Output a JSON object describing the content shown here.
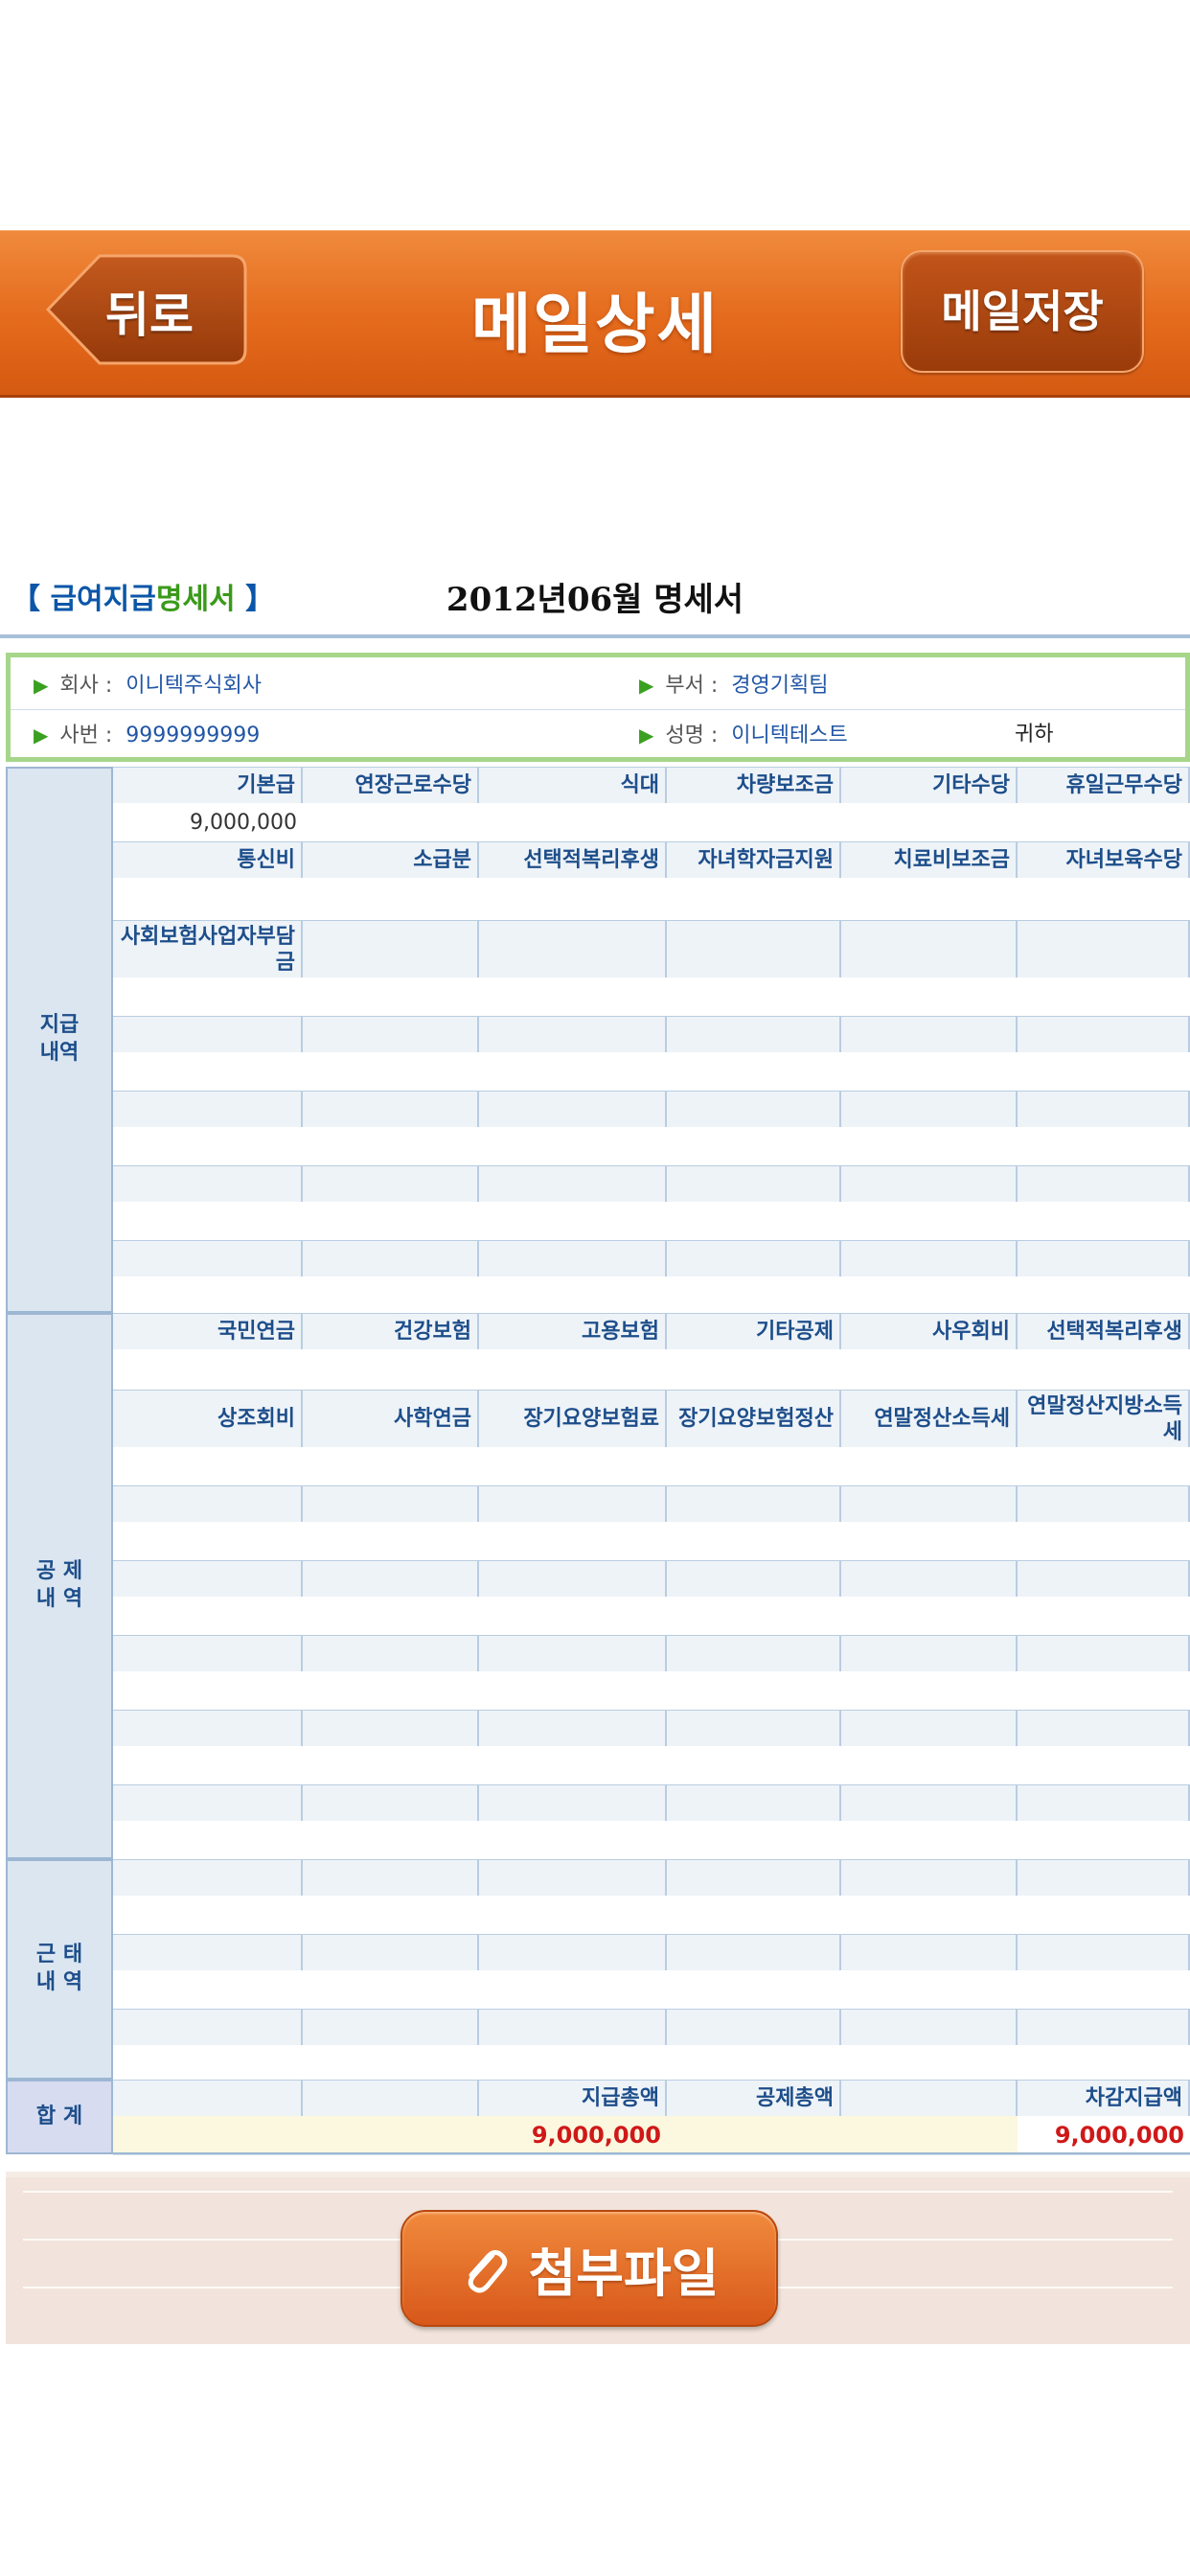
{
  "header": {
    "back_label": "뒤로",
    "title": "메일상세",
    "save_label": "메일저장"
  },
  "document": {
    "label_open": "【 급여지급",
    "label_hi": "명세서",
    "label_close": " 】",
    "title": "2012년06월 명세서"
  },
  "info": {
    "company_label": "회사 :",
    "company": "이니텍주식회사",
    "dept_label": "부서 :",
    "dept": "경영기획팀",
    "emp_label": "사번 :",
    "emp_no": "9999999999",
    "name_label": "성명 :",
    "name": "이니텍테스트",
    "honorific": "귀하"
  },
  "sections": {
    "pay": "지급\n내역",
    "deduct": "공 제\n내 역",
    "attend": "근 태\n내 역",
    "total": "합 계"
  },
  "pay": {
    "row1": [
      "기본급",
      "연장근로수당",
      "식대",
      "차량보조금",
      "기타수당",
      "휴일근무수당"
    ],
    "row1_values": [
      "9,000,000",
      "",
      "",
      "",
      "",
      ""
    ],
    "row2": [
      "통신비",
      "소급분",
      "선택적복리후생",
      "자녀학자금지원",
      "치료비보조금",
      "자녀보육수당"
    ],
    "row3": [
      "사회보험사업자부담금",
      "",
      "",
      "",
      "",
      ""
    ]
  },
  "deduct": {
    "row1": [
      "국민연금",
      "건강보험",
      "고용보험",
      "기타공제",
      "사우회비",
      "선택적복리후생"
    ],
    "row2": [
      "상조회비",
      "사학연금",
      "장기요양보험료",
      "장기요양보험정산",
      "연말정산소득세",
      "연말정산지방소득세"
    ]
  },
  "totals": {
    "labels": [
      "",
      "",
      "지급총액",
      "공제총액",
      "",
      "차감지급액"
    ],
    "values": [
      "",
      "",
      "9,000,000",
      "",
      "",
      "9,000,000"
    ]
  },
  "attachment": {
    "label": "첨부파일"
  },
  "colors": {
    "nav_orange": "#e46a1c",
    "label_blue": "#1d4e8a",
    "total_red": "#d01818",
    "info_green": "#a6d68a"
  }
}
